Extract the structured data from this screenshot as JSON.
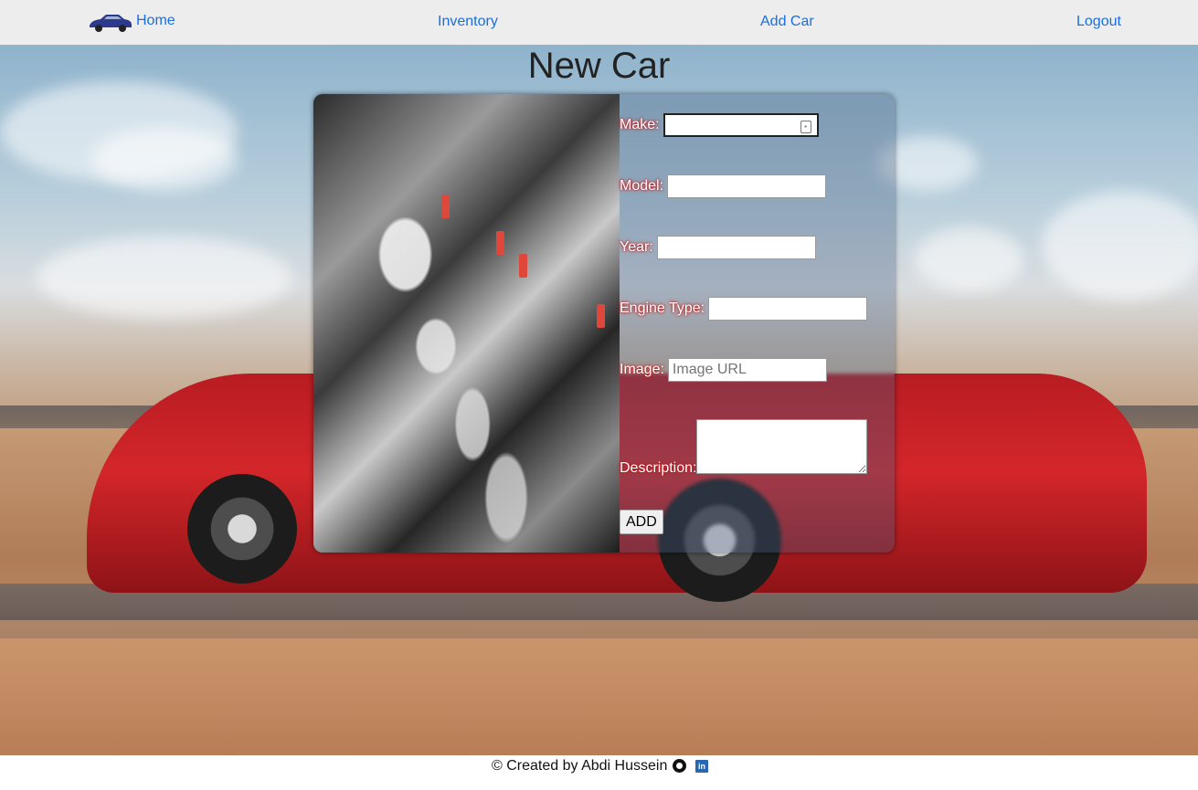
{
  "nav": {
    "home": "Home",
    "inventory": "Inventory",
    "add_car": "Add Car",
    "logout": "Logout",
    "logo_icon": "car-logo-icon"
  },
  "page": {
    "title": "New Car"
  },
  "form": {
    "make_label": "Make:",
    "model_label": "Model:",
    "year_label": "Year:",
    "engine_label": "Engine Type:",
    "image_label": "Image:",
    "image_placeholder": "Image URL",
    "description_label": "Description:",
    "submit_label": "ADD"
  },
  "footer": {
    "text": "© Created by Abdi Hussein",
    "github_icon": "github-icon",
    "linkedin_icon": "linkedin-icon"
  },
  "colors": {
    "link": "#1a6fe0",
    "navbar": "#ededed",
    "label_glow": "#cc2222"
  }
}
